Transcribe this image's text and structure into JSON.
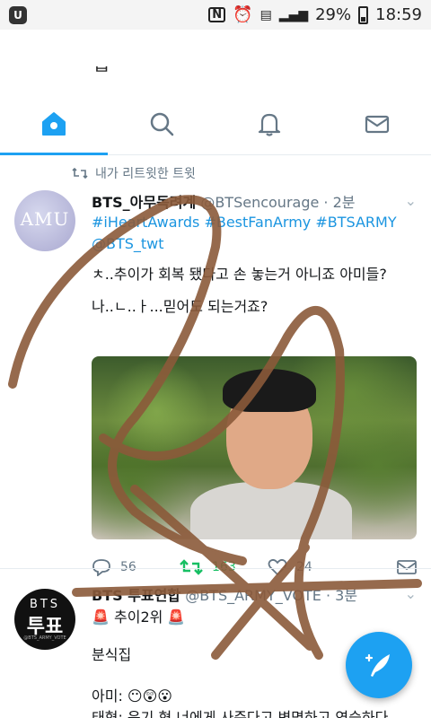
{
  "status_bar": {
    "nfc": "N",
    "battery": "29%",
    "time": "18:59"
  },
  "header": {
    "title": "ᆸ"
  },
  "tabs": [
    {
      "name": "home",
      "icon": "home-icon",
      "active": true
    },
    {
      "name": "search",
      "icon": "search-icon"
    },
    {
      "name": "notifications",
      "icon": "bell-icon"
    },
    {
      "name": "messages",
      "icon": "mail-icon"
    }
  ],
  "retweet_context": {
    "label": "내가 리트윗한 트윗"
  },
  "tweet1": {
    "avatar_text": "AMU",
    "name": "BTS_아무독려계",
    "handle": "@BTSencourage",
    "time": "· 2분",
    "hashtags": "#iHeartAwards #BestFanArmy #BTSARMY",
    "mention": "@BTS_twt",
    "text1": "ㅊ..추이가 회복 됐다고 손 놓는거 아니죠 아미들?",
    "text2": "나..ㄴ..ㅏ...믿어도 되는거죠?",
    "replies": "56",
    "retweets": "163",
    "likes": "24"
  },
  "tweet2": {
    "avatar_line1": "BTS",
    "avatar_line2": "투표",
    "avatar_line3": "@BTS_ARMY_VOTE",
    "name": "BTS 투표연합",
    "handle": "@BTS_ARMY_VOTE",
    "time": "· 3분",
    "line1": "🚨 추이2위 🚨",
    "line2": "분식집",
    "line3": "아미: 😶😲😮",
    "line4": "태형: 윤기 형 너에게 사준다고 변명하고 연습하다"
  },
  "colors": {
    "accent": "#1da1f2",
    "retweet_green": "#17bf63",
    "muted": "#657786",
    "scribble": "#8b5a3a"
  }
}
